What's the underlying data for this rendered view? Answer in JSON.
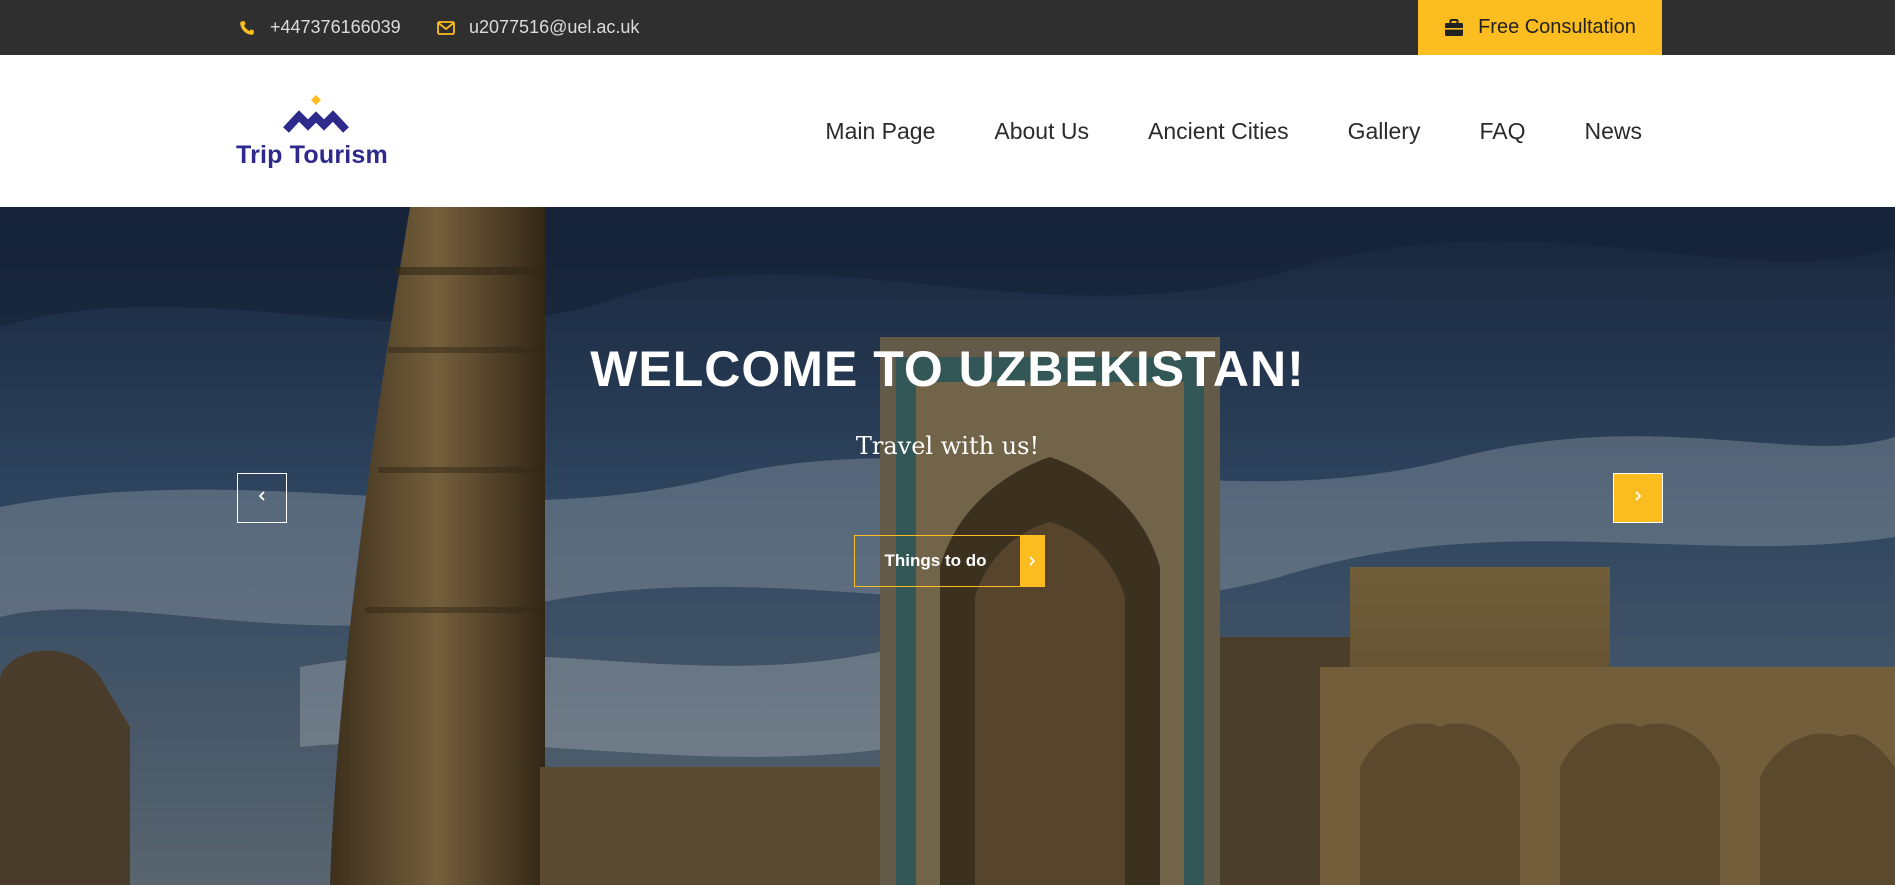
{
  "topbar": {
    "phone": "+447376166039",
    "email": "u2077516@uel.ac.uk",
    "consultation_label": "Free Consultation",
    "phone_icon": "phone-icon",
    "email_icon": "envelope-icon",
    "consultation_icon": "briefcase-icon"
  },
  "header": {
    "logo_text": "Trip Tourism",
    "nav": [
      {
        "label": "Main Page"
      },
      {
        "label": "About Us"
      },
      {
        "label": "Ancient Cities"
      },
      {
        "label": "Gallery"
      },
      {
        "label": "FAQ"
      },
      {
        "label": "News"
      }
    ]
  },
  "hero": {
    "title": "WELCOME TO UZBEKISTAN!",
    "subtitle": "Travel with us!",
    "cta_label": "Things to do",
    "prev_icon": "chevron-left-icon",
    "next_icon": "chevron-right-icon"
  },
  "colors": {
    "accent": "#fcbd21",
    "topbar_bg": "#2f2f2f",
    "brand": "#2e2a8c",
    "text_dark": "#2b2b2b"
  }
}
